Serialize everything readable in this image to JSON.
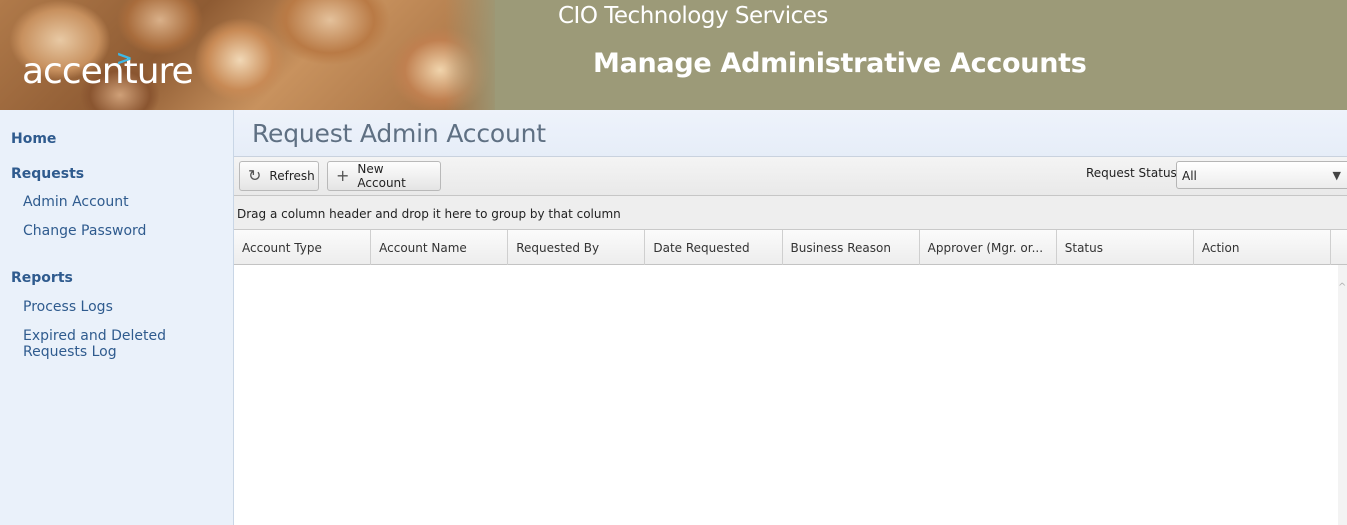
{
  "header": {
    "logo_text": "accenture",
    "logo_arrow": ">",
    "org_title": "CIO Technology Services",
    "page_heading": "Manage Administrative Accounts"
  },
  "sidebar": {
    "home": "Home",
    "requests_section": "Requests",
    "requests_items": [
      {
        "label": "Admin Account"
      },
      {
        "label": "Change Password"
      }
    ],
    "reports_section": "Reports",
    "reports_items": [
      {
        "label": "Process Logs"
      },
      {
        "label": "Expired and Deleted Requests Log"
      }
    ]
  },
  "main": {
    "title": "Request Admin Account",
    "toolbar": {
      "refresh_label": "Refresh",
      "refresh_icon": "refresh-icon",
      "new_account_label": "New Account",
      "new_account_icon": "plus-icon",
      "status_label": "Request Status:",
      "status_value": "All"
    },
    "group_hint": "Drag a column header and drop it here to group by that column",
    "columns": [
      "Account Type",
      "Account Name",
      "Requested By",
      "Date Requested",
      "Business Reason",
      "Approver (Mgr. or...",
      "Status",
      "Action"
    ],
    "rows": []
  },
  "colors": {
    "banner": "#9c9a78",
    "sidebar_bg": "#eaf1fa",
    "nav_text": "#2f5b8e",
    "title_text": "#5f7083",
    "logo_arrow": "#3db8e6"
  }
}
